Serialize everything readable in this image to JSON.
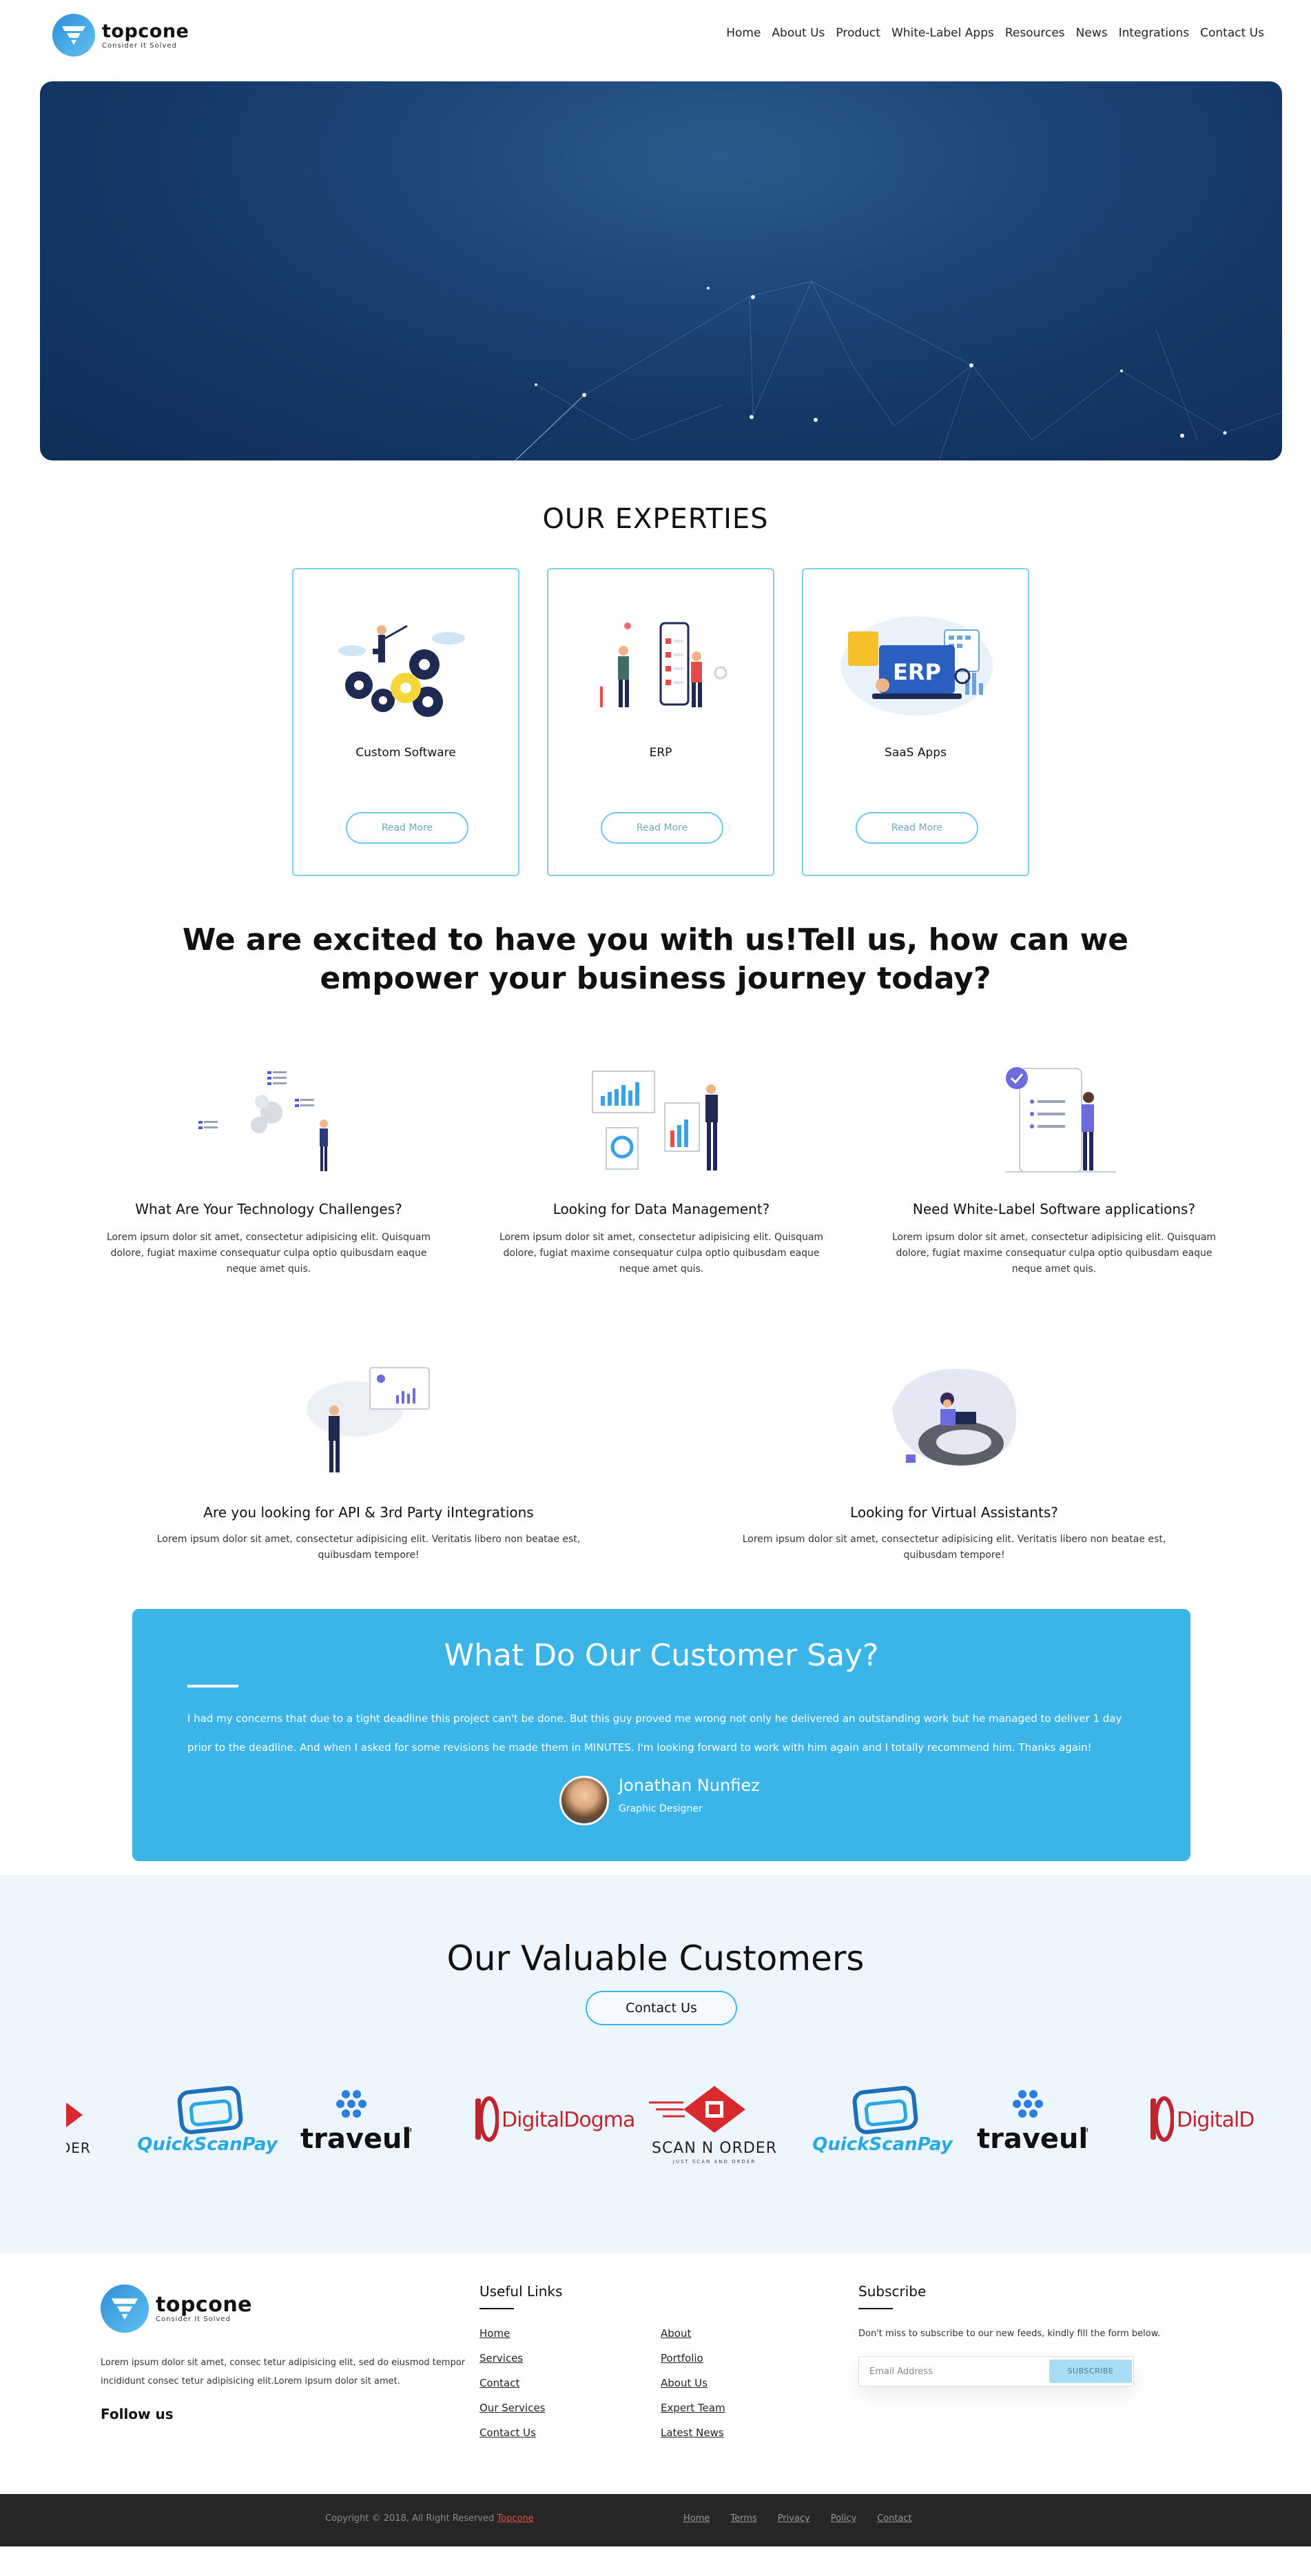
{
  "brand": {
    "name": "topcone",
    "tagline": "Consider It Solved"
  },
  "nav": [
    {
      "label": "Home"
    },
    {
      "label": "About Us"
    },
    {
      "label": "Product"
    },
    {
      "label": "White-Label Apps"
    },
    {
      "label": "Resources"
    },
    {
      "label": "News"
    },
    {
      "label": "Integrations"
    },
    {
      "label": "Contact Us"
    }
  ],
  "experties": {
    "title": "OUR EXPERTIES",
    "cards": [
      {
        "label": "Custom Software",
        "button": "Read More",
        "icon": "gears-illustration"
      },
      {
        "label": "ERP",
        "button": "Read More",
        "icon": "phone-team-illustration"
      },
      {
        "label": "SaaS Apps",
        "button": "Read More",
        "icon": "erp-laptop-illustration"
      }
    ]
  },
  "excite": {
    "heading": "We are excited to have you with us!Tell us, how can we empower your business journey today?"
  },
  "features": [
    {
      "title": "What Are Your Technology Challenges?",
      "desc": "Lorem ipsum dolor sit amet, consectetur adipisicing elit. Quisquam dolore, fugiat maxime consequatur culpa optio quibusdam eaque neque amet quis."
    },
    {
      "title": "Looking for Data Management?",
      "desc": "Lorem ipsum dolor sit amet, consectetur adipisicing elit. Quisquam dolore, fugiat maxime consequatur culpa optio quibusdam eaque neque amet quis."
    },
    {
      "title": "Need White-Label Software applications?",
      "desc": "Lorem ipsum dolor sit amet, consectetur adipisicing elit. Quisquam dolore, fugiat maxime consequatur culpa optio quibusdam eaque neque amet quis."
    },
    {
      "title": "Are you looking for API & 3rd Party iIntegrations",
      "desc": "Lorem ipsum dolor sit amet, consectetur adipisicing elit. Veritatis libero non beatae est, quibusdam tempore!"
    },
    {
      "title": "Looking for Virtual Assistants?",
      "desc": "Lorem ipsum dolor sit amet, consectetur adipisicing elit. Veritatis libero non beatae est, quibusdam tempore!"
    }
  ],
  "testimonial": {
    "title": "What Do Our Customer Say?",
    "quote": "I had my concerns that due to a tight deadline this project can't be done. But this guy proved me wrong not only he delivered an outstanding work but he managed to deliver 1 day prior to the deadline. And when I asked for some revisions he made them in MINUTES. I'm looking forward to work with him again and I totally recommend him. Thanks again!",
    "name": "Jonathan Nunfiez",
    "role": "Graphic Designer"
  },
  "customers": {
    "title": "Our Valuable Customers",
    "button": "Contact Us",
    "logos": [
      {
        "main": "RDER",
        "sub": ""
      },
      {
        "main": "QuickScanPay",
        "sub": ""
      },
      {
        "main": "traveul",
        "sub": "TM"
      },
      {
        "main": "DigitalDogma",
        "sub": ""
      },
      {
        "main": "SCAN N ORDER",
        "sub": "JUST SCAN AND ORDER"
      },
      {
        "main": "QuickScanPay",
        "sub": ""
      },
      {
        "main": "traveul",
        "sub": "TM"
      },
      {
        "main": "DigitalDo",
        "sub": ""
      }
    ]
  },
  "footer": {
    "about": "Lorem ipsum dolor sit amet, consec tetur adipisicing elit, sed do eiusmod tempor incididunt consec tetur adipisicing elit.Lorem ipsum dolor sit amet.",
    "follow": "Follow us",
    "useful_title": "Useful Links",
    "links_col1": [
      "Home",
      "Services",
      "Contact",
      "Our Services",
      "Contact Us"
    ],
    "links_col2": [
      "About",
      "Portfolio",
      "About Us",
      "Expert Team",
      "Latest News"
    ],
    "subscribe_title": "Subscribe",
    "subscribe_text": "Don't miss to subscribe to our new feeds, kindly fill the form below.",
    "email_placeholder": "Email Address",
    "subscribe_button": "SUBSCRIBE",
    "copyright": "Copyright © 2018, All Right Reserved",
    "copyright_brand": "Topcone",
    "bottom_links": [
      "Home",
      "Terms",
      "Privacy",
      "Policy",
      "Contact"
    ]
  },
  "colors": {
    "accent": "#3bb4e7",
    "hero": "#143866",
    "footer_bar": "#262626"
  }
}
